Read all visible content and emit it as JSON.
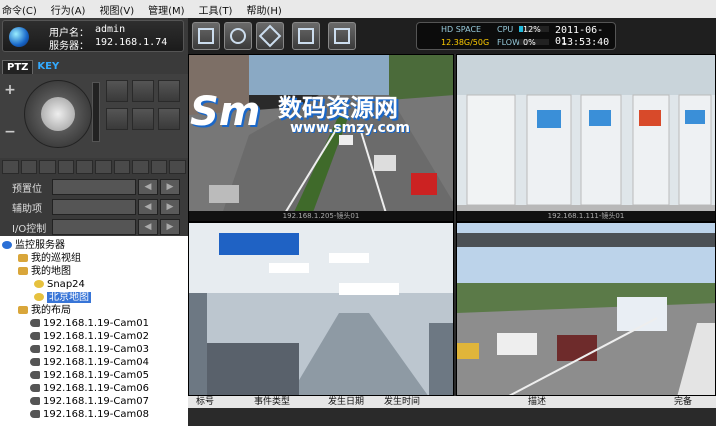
{
  "menu": [
    "命令(C)",
    "行为(A)",
    "视图(V)",
    "管理(M)",
    "工具(T)",
    "帮助(H)"
  ],
  "user": {
    "user_label": "用户名：",
    "user_value": "admin",
    "server_label": "服务器：",
    "server_value": "192.168.1.74"
  },
  "tabs": [
    "PTZ",
    "KEY"
  ],
  "controls": [
    {
      "label": "预置位"
    },
    {
      "label": "辅助项"
    },
    {
      "label": "I/O控制"
    }
  ],
  "status": {
    "hd_space_label": "HD SPACE",
    "hd_space_value": "12.38G/50G",
    "cpu_label": "CPU",
    "cpu_value": "12%",
    "cpu_fraction": 0.12,
    "flow_label": "FLOW",
    "flow_value": "0%",
    "flow_fraction": 0.0,
    "date": "2011-06-01",
    "time": "13:53:40"
  },
  "video_labels": [
    "192.168.1.205-镜头01",
    "192.168.1.111-镜头01"
  ],
  "watermark": {
    "logo": "Sm",
    "text": "数码资源网",
    "url": "www.smzy.com"
  },
  "tree": [
    {
      "label": "监控服务器",
      "icon": "server-icon"
    },
    {
      "label": "我的巡视组",
      "icon": "folder-icon"
    },
    {
      "label": "我的地图",
      "icon": "folder-icon"
    },
    {
      "label": "Snap24",
      "icon": "map-icon"
    },
    {
      "label": "北京地图",
      "icon": "map-icon"
    },
    {
      "label": "我的布局",
      "icon": "folder-icon"
    },
    {
      "label": "192.168.1.19-Cam01",
      "icon": "camera-icon"
    },
    {
      "label": "192.168.1.19-Cam02",
      "icon": "camera-icon"
    },
    {
      "label": "192.168.1.19-Cam03",
      "icon": "camera-icon"
    },
    {
      "label": "192.168.1.19-Cam04",
      "icon": "camera-icon"
    },
    {
      "label": "192.168.1.19-Cam05",
      "icon": "camera-icon"
    },
    {
      "label": "192.168.1.19-Cam06",
      "icon": "camera-icon"
    },
    {
      "label": "192.168.1.19-Cam07",
      "icon": "camera-icon"
    },
    {
      "label": "192.168.1.19-Cam08",
      "icon": "camera-icon"
    }
  ],
  "events": {
    "headers": [
      "标号",
      "事件类型",
      "发生日期",
      "发生时间",
      "描述",
      "完备"
    ]
  }
}
